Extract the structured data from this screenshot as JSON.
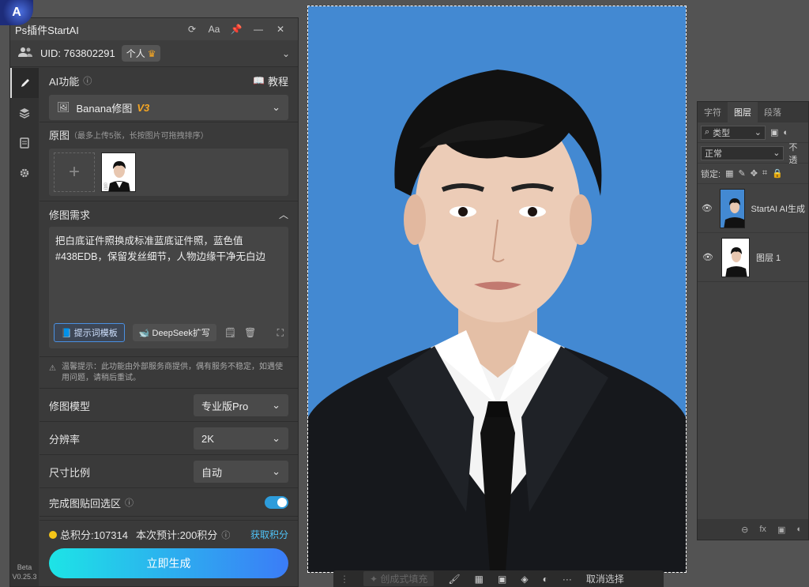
{
  "plugin": {
    "title": "Ps插件StartAI",
    "titlebar_font_icon": "Aa",
    "uid_label": "UID: 763802291",
    "account_badge": "个人",
    "version_beta": "Beta",
    "version_number": "V0.25.3"
  },
  "ai": {
    "section_label": "AI功能",
    "tutorial_label": "教程",
    "model_name": "Banana修图",
    "model_version": "V3"
  },
  "original": {
    "label": "原图",
    "hint": "（最多上传5张，长按图片可拖拽排序）",
    "thumb_index": "1"
  },
  "request": {
    "label": "修图需求",
    "text": "把白底证件照换成标准蓝底证件照，蓝色值#438EDB，保留发丝细节，人物边缘干净无白边",
    "template_button": "提示词模板",
    "deepseek_button": "DeepSeek扩写"
  },
  "tip": "温馨提示：此功能由外部服务商提供，偶有服务不稳定，如遇使用问题，请稍后重试。",
  "settings": [
    {
      "label": "修图模型",
      "value": "专业版Pro"
    },
    {
      "label": "分辨率",
      "value": "2K"
    },
    {
      "label": "尺寸比例",
      "value": "自动"
    }
  ],
  "paste_back": {
    "label": "完成图贴回选区",
    "enabled": true
  },
  "points": {
    "total": "总积分:107314",
    "estimate": "本次预计:200积分",
    "earn_link": "获取积分"
  },
  "generate_button": "立即生成",
  "context_bar": {
    "generative_fill": "创成式填充",
    "deselect": "取消选择"
  },
  "layers_panel": {
    "tabs": [
      "字符",
      "图层",
      "段落"
    ],
    "filter": "类型",
    "blend_mode": "正常",
    "opacity_label": "不透",
    "lock_label": "锁定:",
    "layers": [
      {
        "name": "StartAI AI生成"
      },
      {
        "name": "图层 1"
      }
    ]
  },
  "colors": {
    "canvas_bg": "#4389d2",
    "accent": "#2d9cdb",
    "version": "#f5a623"
  }
}
